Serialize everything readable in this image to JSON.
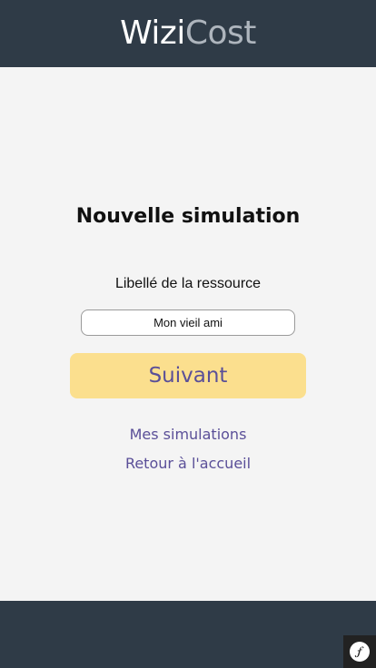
{
  "header": {
    "brand_part1": "Wizi",
    "brand_part2": "Cost"
  },
  "main": {
    "title": "Nouvelle simulation",
    "field_label": "Libellé de la ressource",
    "field_value": "Mon vieil ami",
    "next_button": "Suivant",
    "links": {
      "simulations": "Mes simulations",
      "home": "Retour à l'accueil"
    }
  },
  "footer": {
    "badge_icon": "symfony-icon"
  },
  "colors": {
    "header_bg": "#2f3b47",
    "page_bg": "#f4f4f4",
    "button_bg": "#fbdf8e",
    "accent_text": "#5a4f98"
  }
}
